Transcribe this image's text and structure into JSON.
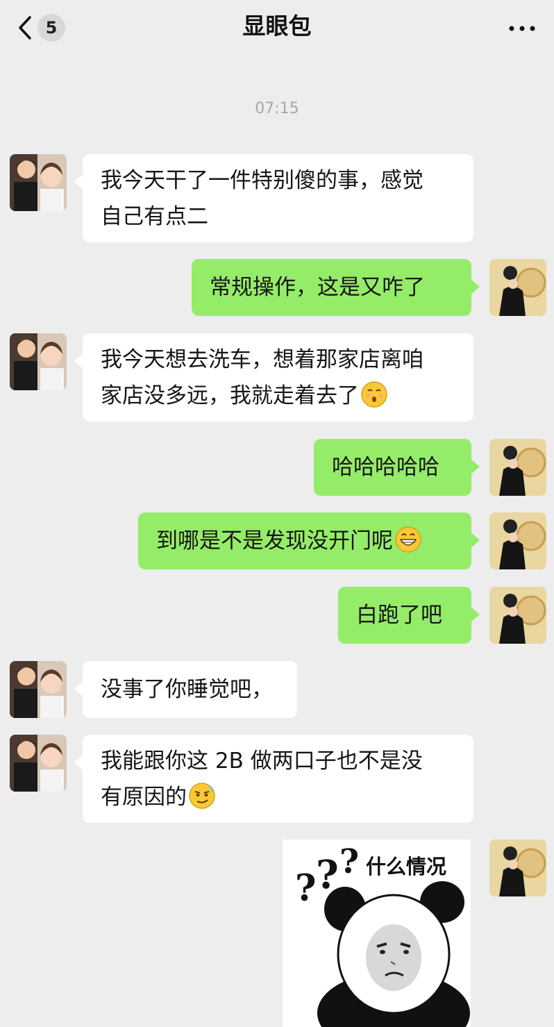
{
  "header": {
    "title": "显眼包",
    "unread_count": "5",
    "back_icon": "chevron-left-icon",
    "more_icon": "more-dots-icon"
  },
  "timestamp": "07:15",
  "messages": [
    {
      "from": "other",
      "text": "我今天干了一件特别傻的事，感觉\n自己有点二"
    },
    {
      "from": "me",
      "text": "常规操作，这是又咋了"
    },
    {
      "from": "other",
      "text": "我今天想去洗车，想着那家店离咱\n家店没多远，我就走着去了",
      "emoji": "shush-face-emoji"
    },
    {
      "from": "me",
      "text": "哈哈哈哈哈"
    },
    {
      "from": "me",
      "text": "到哪是不是发现没开门呢",
      "emoji": "grinning-face-emoji"
    },
    {
      "from": "me",
      "text": "白跑了吧"
    },
    {
      "from": "other",
      "text": "没事了你睡觉吧，"
    },
    {
      "from": "other",
      "text": "我能跟你这 2B 做两口子也不是没\n有原因的",
      "emoji": "smirk-face-emoji"
    },
    {
      "from": "me",
      "sticker": "panda-meme-sticker",
      "sticker_text": "什么情况"
    }
  ],
  "colors": {
    "background": "#ededed",
    "incoming_bubble": "#ffffff",
    "outgoing_bubble": "#95ec69",
    "timestamp": "#a8a8a8"
  }
}
